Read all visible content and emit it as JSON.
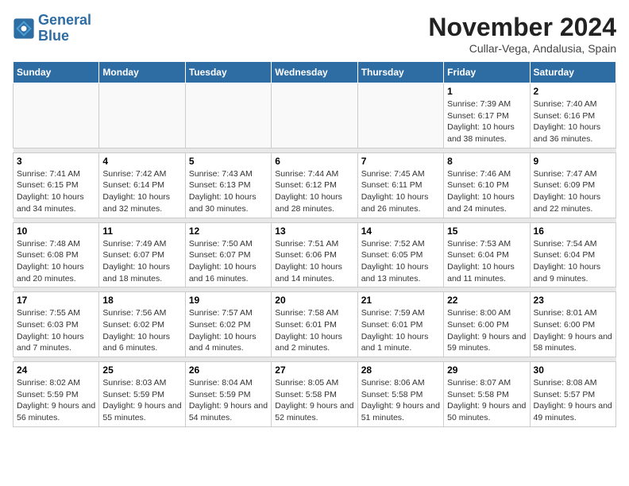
{
  "header": {
    "logo_line1": "General",
    "logo_line2": "Blue",
    "month": "November 2024",
    "location": "Cullar-Vega, Andalusia, Spain"
  },
  "days_of_week": [
    "Sunday",
    "Monday",
    "Tuesday",
    "Wednesday",
    "Thursday",
    "Friday",
    "Saturday"
  ],
  "weeks": [
    [
      {
        "day": "",
        "info": ""
      },
      {
        "day": "",
        "info": ""
      },
      {
        "day": "",
        "info": ""
      },
      {
        "day": "",
        "info": ""
      },
      {
        "day": "",
        "info": ""
      },
      {
        "day": "1",
        "info": "Sunrise: 7:39 AM\nSunset: 6:17 PM\nDaylight: 10 hours and 38 minutes."
      },
      {
        "day": "2",
        "info": "Sunrise: 7:40 AM\nSunset: 6:16 PM\nDaylight: 10 hours and 36 minutes."
      }
    ],
    [
      {
        "day": "3",
        "info": "Sunrise: 7:41 AM\nSunset: 6:15 PM\nDaylight: 10 hours and 34 minutes."
      },
      {
        "day": "4",
        "info": "Sunrise: 7:42 AM\nSunset: 6:14 PM\nDaylight: 10 hours and 32 minutes."
      },
      {
        "day": "5",
        "info": "Sunrise: 7:43 AM\nSunset: 6:13 PM\nDaylight: 10 hours and 30 minutes."
      },
      {
        "day": "6",
        "info": "Sunrise: 7:44 AM\nSunset: 6:12 PM\nDaylight: 10 hours and 28 minutes."
      },
      {
        "day": "7",
        "info": "Sunrise: 7:45 AM\nSunset: 6:11 PM\nDaylight: 10 hours and 26 minutes."
      },
      {
        "day": "8",
        "info": "Sunrise: 7:46 AM\nSunset: 6:10 PM\nDaylight: 10 hours and 24 minutes."
      },
      {
        "day": "9",
        "info": "Sunrise: 7:47 AM\nSunset: 6:09 PM\nDaylight: 10 hours and 22 minutes."
      }
    ],
    [
      {
        "day": "10",
        "info": "Sunrise: 7:48 AM\nSunset: 6:08 PM\nDaylight: 10 hours and 20 minutes."
      },
      {
        "day": "11",
        "info": "Sunrise: 7:49 AM\nSunset: 6:07 PM\nDaylight: 10 hours and 18 minutes."
      },
      {
        "day": "12",
        "info": "Sunrise: 7:50 AM\nSunset: 6:07 PM\nDaylight: 10 hours and 16 minutes."
      },
      {
        "day": "13",
        "info": "Sunrise: 7:51 AM\nSunset: 6:06 PM\nDaylight: 10 hours and 14 minutes."
      },
      {
        "day": "14",
        "info": "Sunrise: 7:52 AM\nSunset: 6:05 PM\nDaylight: 10 hours and 13 minutes."
      },
      {
        "day": "15",
        "info": "Sunrise: 7:53 AM\nSunset: 6:04 PM\nDaylight: 10 hours and 11 minutes."
      },
      {
        "day": "16",
        "info": "Sunrise: 7:54 AM\nSunset: 6:04 PM\nDaylight: 10 hours and 9 minutes."
      }
    ],
    [
      {
        "day": "17",
        "info": "Sunrise: 7:55 AM\nSunset: 6:03 PM\nDaylight: 10 hours and 7 minutes."
      },
      {
        "day": "18",
        "info": "Sunrise: 7:56 AM\nSunset: 6:02 PM\nDaylight: 10 hours and 6 minutes."
      },
      {
        "day": "19",
        "info": "Sunrise: 7:57 AM\nSunset: 6:02 PM\nDaylight: 10 hours and 4 minutes."
      },
      {
        "day": "20",
        "info": "Sunrise: 7:58 AM\nSunset: 6:01 PM\nDaylight: 10 hours and 2 minutes."
      },
      {
        "day": "21",
        "info": "Sunrise: 7:59 AM\nSunset: 6:01 PM\nDaylight: 10 hours and 1 minute."
      },
      {
        "day": "22",
        "info": "Sunrise: 8:00 AM\nSunset: 6:00 PM\nDaylight: 9 hours and 59 minutes."
      },
      {
        "day": "23",
        "info": "Sunrise: 8:01 AM\nSunset: 6:00 PM\nDaylight: 9 hours and 58 minutes."
      }
    ],
    [
      {
        "day": "24",
        "info": "Sunrise: 8:02 AM\nSunset: 5:59 PM\nDaylight: 9 hours and 56 minutes."
      },
      {
        "day": "25",
        "info": "Sunrise: 8:03 AM\nSunset: 5:59 PM\nDaylight: 9 hours and 55 minutes."
      },
      {
        "day": "26",
        "info": "Sunrise: 8:04 AM\nSunset: 5:59 PM\nDaylight: 9 hours and 54 minutes."
      },
      {
        "day": "27",
        "info": "Sunrise: 8:05 AM\nSunset: 5:58 PM\nDaylight: 9 hours and 52 minutes."
      },
      {
        "day": "28",
        "info": "Sunrise: 8:06 AM\nSunset: 5:58 PM\nDaylight: 9 hours and 51 minutes."
      },
      {
        "day": "29",
        "info": "Sunrise: 8:07 AM\nSunset: 5:58 PM\nDaylight: 9 hours and 50 minutes."
      },
      {
        "day": "30",
        "info": "Sunrise: 8:08 AM\nSunset: 5:57 PM\nDaylight: 9 hours and 49 minutes."
      }
    ]
  ]
}
